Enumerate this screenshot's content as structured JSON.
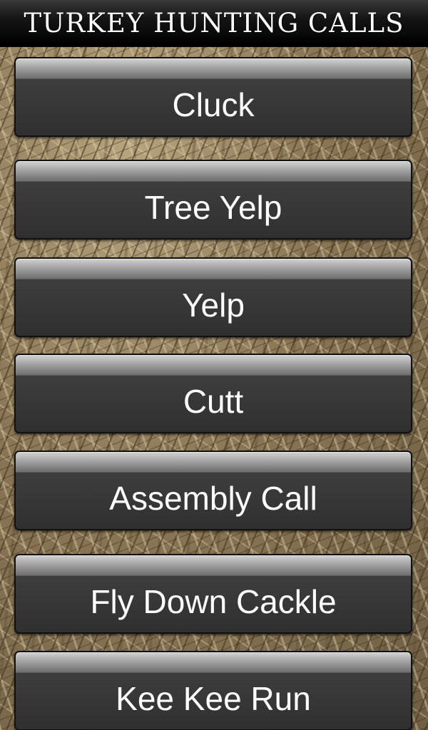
{
  "header": {
    "title": "TURKEY HUNTING CALLS"
  },
  "calls": [
    {
      "label": "Cluck"
    },
    {
      "label": "Tree Yelp"
    },
    {
      "label": "Yelp"
    },
    {
      "label": "Cutt"
    },
    {
      "label": "Assembly Call"
    },
    {
      "label": "Fly Down Cackle"
    },
    {
      "label": "Kee Kee Run"
    }
  ],
  "theme": {
    "title_bar_color": "#000000",
    "button_color": "#303030",
    "button_text_color": "#ffffff",
    "background": "camouflage-grass"
  }
}
